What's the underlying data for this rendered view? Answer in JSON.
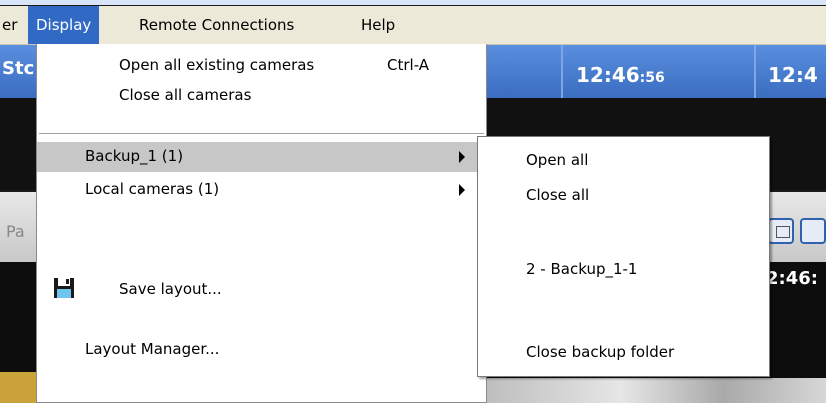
{
  "menubar": {
    "items": [
      {
        "label": "er",
        "active": false
      },
      {
        "label": "Display",
        "active": true
      },
      {
        "label": "Remote Connections",
        "active": false
      },
      {
        "label": "Help",
        "active": false
      }
    ]
  },
  "background": {
    "top_left_text": "Stc",
    "clock_1": {
      "main": "12:46",
      "secs": ":56"
    },
    "clock_2": "12:4",
    "panel_text": "Pa",
    "clock_3": "2:46:"
  },
  "display_menu": {
    "open_all_existing": {
      "label": "Open all existing cameras",
      "shortcut": "Ctrl-A"
    },
    "close_all": {
      "label": "Close all cameras"
    },
    "backup_1": {
      "label": "Backup_1 (1)"
    },
    "local_cameras": {
      "label": "Local cameras (1)"
    },
    "save_layout": {
      "label": "Save layout...",
      "icon": "floppy-disk-icon"
    },
    "layout_manager": {
      "label": "Layout Manager..."
    }
  },
  "submenu": {
    "open_all": "Open all",
    "close_all": "Close all",
    "camera": "2 - Backup_1-1",
    "close_backup_folder": "Close backup folder"
  },
  "colors": {
    "menu_active": "#316ac5",
    "menu_bar": "#ece9d8",
    "hover": "#c7c7c7"
  }
}
